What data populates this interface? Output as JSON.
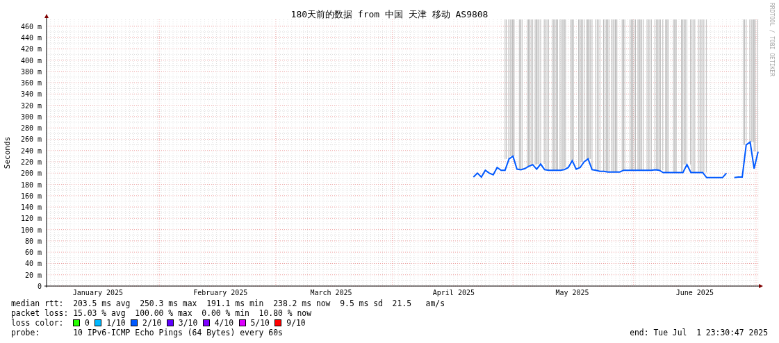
{
  "title": "180天前的数据 from 中国 天津 移动 AS9808",
  "side_mark": "RRDTOOL / TOBI OETIKER",
  "chart": {
    "chart_data": {
      "type": "line",
      "grid": true,
      "ylabel": "Seconds",
      "ylim": [
        0,
        472
      ],
      "categories": [
        null,
        null,
        null,
        null,
        null,
        null,
        null,
        null,
        null,
        null,
        null,
        null,
        null,
        "January 2025",
        null,
        null,
        null,
        null,
        null,
        null,
        null,
        null,
        null,
        null,
        null,
        null,
        null,
        null,
        null,
        null,
        null,
        null,
        null,
        null,
        null,
        null,
        null,
        null,
        null,
        null,
        null,
        null,
        null,
        null,
        "February 2025",
        null,
        null,
        null,
        null,
        null,
        null,
        null,
        null,
        null,
        null,
        null,
        null,
        null,
        null,
        null,
        null,
        null,
        null,
        null,
        null,
        null,
        null,
        null,
        null,
        null,
        null,
        null,
        "March 2025",
        null,
        null,
        null,
        null,
        null,
        null,
        null,
        null,
        null,
        null,
        null,
        null,
        null,
        null,
        null,
        null,
        null,
        null,
        null,
        null,
        null,
        null,
        null,
        null,
        null,
        null,
        null,
        null,
        null,
        null,
        "April 2025",
        null,
        null,
        null,
        null,
        null,
        null,
        null,
        null,
        null,
        null,
        null,
        null,
        null,
        null,
        null,
        null,
        null,
        null,
        null,
        null,
        null,
        null,
        null,
        null,
        null,
        null,
        null,
        null,
        null,
        "May 2025",
        null,
        null,
        null,
        null,
        null,
        null,
        null,
        null,
        null,
        null,
        null,
        null,
        null,
        null,
        null,
        null,
        null,
        null,
        null,
        null,
        null,
        null,
        null,
        null,
        null,
        null,
        null,
        null,
        null,
        null,
        "June 2025",
        null,
        null,
        null,
        null,
        null,
        null,
        null,
        null,
        null,
        null,
        null,
        null,
        null,
        null,
        null,
        null
      ],
      "yticks": [
        {
          "value": 0,
          "label": "0"
        },
        {
          "value": 20,
          "label": "20 m"
        },
        {
          "value": 40,
          "label": "40 m"
        },
        {
          "value": 60,
          "label": "60 m"
        },
        {
          "value": 80,
          "label": "80 m"
        },
        {
          "value": 100,
          "label": "100 m"
        },
        {
          "value": 120,
          "label": "120 m"
        },
        {
          "value": 140,
          "label": "140 m"
        },
        {
          "value": 160,
          "label": "160 m"
        },
        {
          "value": 180,
          "label": "180 m"
        },
        {
          "value": 200,
          "label": "200 m"
        },
        {
          "value": 220,
          "label": "220 m"
        },
        {
          "value": 240,
          "label": "240 m"
        },
        {
          "value": 260,
          "label": "260 m"
        },
        {
          "value": 280,
          "label": "280 m"
        },
        {
          "value": 300,
          "label": "300 m"
        },
        {
          "value": 320,
          "label": "320 m"
        },
        {
          "value": 340,
          "label": "340 m"
        },
        {
          "value": 360,
          "label": "360 m"
        },
        {
          "value": 380,
          "label": "380 m"
        },
        {
          "value": 400,
          "label": "400 m"
        },
        {
          "value": 420,
          "label": "420 m"
        },
        {
          "value": 440,
          "label": "440 m"
        },
        {
          "value": 460,
          "label": "460 m"
        }
      ],
      "series": [
        {
          "color": "#0059ff",
          "values": [
            null,
            null,
            null,
            null,
            null,
            null,
            null,
            null,
            null,
            null,
            null,
            null,
            null,
            null,
            null,
            null,
            null,
            null,
            null,
            null,
            null,
            null,
            null,
            null,
            null,
            null,
            null,
            null,
            null,
            null,
            null,
            null,
            null,
            null,
            null,
            null,
            null,
            null,
            null,
            null,
            null,
            null,
            null,
            null,
            null,
            null,
            null,
            null,
            null,
            null,
            null,
            null,
            null,
            null,
            null,
            null,
            null,
            null,
            null,
            null,
            null,
            null,
            null,
            null,
            null,
            null,
            null,
            null,
            null,
            null,
            null,
            null,
            null,
            null,
            null,
            null,
            null,
            null,
            null,
            null,
            null,
            null,
            null,
            null,
            null,
            null,
            null,
            null,
            null,
            null,
            null,
            null,
            null,
            null,
            null,
            null,
            null,
            null,
            null,
            null,
            null,
            null,
            null,
            null,
            null,
            null,
            null,
            null,
            193,
            200,
            193,
            205,
            200,
            197,
            210,
            205,
            205,
            225,
            230,
            207,
            206,
            208,
            212,
            215,
            207,
            216,
            206,
            205,
            205,
            205,
            205,
            206,
            210,
            222,
            207,
            210,
            220,
            225,
            206,
            205,
            203,
            203,
            202,
            202,
            202,
            202,
            205,
            205,
            205,
            205,
            205,
            205,
            205,
            205,
            206,
            205,
            201,
            201,
            201,
            201,
            201,
            201,
            215,
            201,
            201,
            201,
            201,
            192,
            192,
            192,
            192,
            192,
            200,
            null,
            192,
            193,
            193,
            250,
            255,
            208,
            238
          ]
        }
      ]
    }
  },
  "legend": {
    "rows": [
      {
        "label": "median rtt:",
        "text": "203.5 ms avg  250.3 ms max  191.1 ms min  238.2 ms now  9.5 ms sd  21.5   am/s"
      },
      {
        "label": "packet loss:",
        "text": "15.03 % avg  100.00 % max  0.00 % min  10.80 % now"
      }
    ],
    "loss_colors": {
      "label": "loss color:",
      "items": [
        {
          "label": "0",
          "color": "#26ff00"
        },
        {
          "label": "1/10",
          "color": "#00b8ff"
        },
        {
          "label": "2/10",
          "color": "#0059ff"
        },
        {
          "label": "3/10",
          "color": "#5e00ff"
        },
        {
          "label": "4/10",
          "color": "#7e00ff"
        },
        {
          "label": "5/10",
          "color": "#dd00ff"
        },
        {
          "label": "9/10",
          "color": "#ff0000"
        }
      ]
    },
    "probe": {
      "label": "probe:",
      "text": "10 IPv6-ICMP Echo Pings (64 Bytes) every 60s"
    },
    "end": "end: Tue Jul  1 23:30:47 2025"
  }
}
